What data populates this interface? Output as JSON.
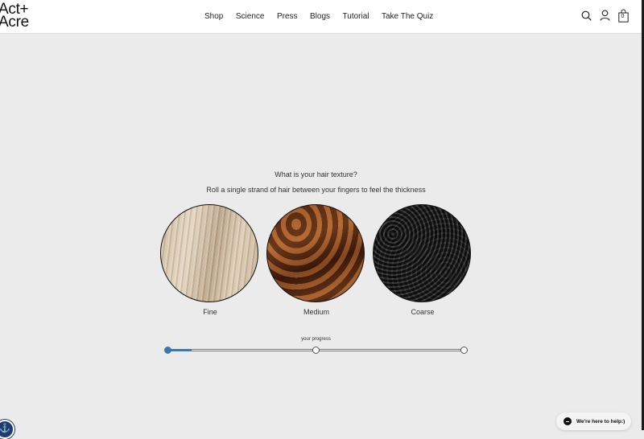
{
  "header": {
    "logo_line1": "Act+",
    "logo_line2": "Acre",
    "nav": [
      "Shop",
      "Science",
      "Press",
      "Blogs",
      "Tutorial",
      "Take The Quiz"
    ],
    "icons": [
      "search-icon",
      "account-icon",
      "cart-icon"
    ],
    "cart_count": "0"
  },
  "quiz": {
    "question": "What is your hair texture?",
    "instruction": "Roll a single strand of hair between your fingers to feel the thickness",
    "options": [
      {
        "label": "Fine"
      },
      {
        "label": "Medium"
      },
      {
        "label": "Coarse"
      }
    ],
    "progress": {
      "label": "your progress",
      "fraction": 0.08,
      "steps": 3,
      "current_step": 1,
      "accent_color": "#3d78ad"
    }
  },
  "widgets": {
    "accessibility_icon": "accessibility-icon",
    "help_label": "We're here to help:)"
  }
}
